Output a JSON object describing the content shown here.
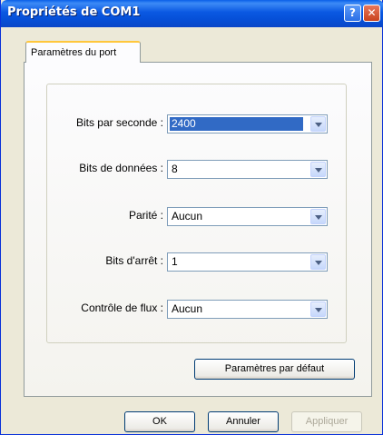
{
  "window": {
    "title": "Propriétés de COM1"
  },
  "titlebar": {
    "help_label": "?",
    "close_label": "✕"
  },
  "tabs": [
    {
      "label": "Paramètres du port"
    }
  ],
  "fields": [
    {
      "label": "Bits par seconde :",
      "value": "2400",
      "selected": true
    },
    {
      "label": "Bits de données :",
      "value": "8"
    },
    {
      "label": "Parité :",
      "value": "Aucun"
    },
    {
      "label": "Bits d'arrêt :",
      "value": "1"
    },
    {
      "label": "Contrôle de flux :",
      "value": "Aucun"
    }
  ],
  "defaults_button": {
    "label": "Paramètres par défaut"
  },
  "footer": {
    "ok_label": "OK",
    "cancel_label": "Annuler",
    "apply_label": "Appliquer"
  }
}
